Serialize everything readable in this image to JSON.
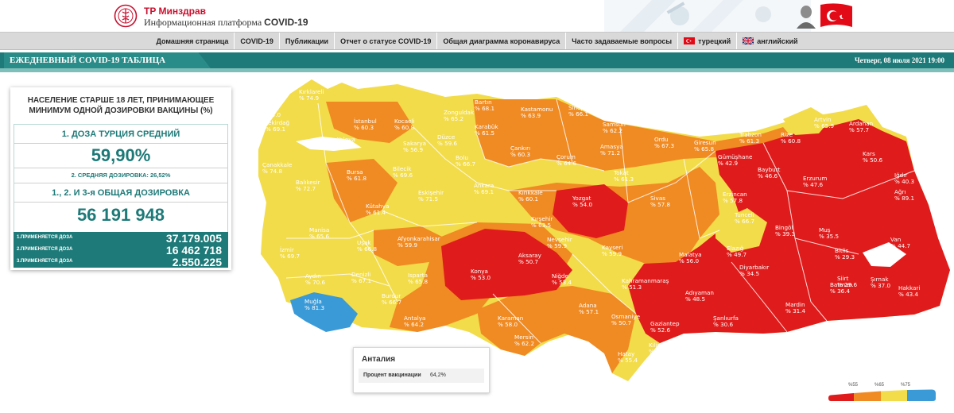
{
  "header": {
    "brand_line1": "TP Минздрав",
    "brand_line2_prefix": "Информационная платформа ",
    "brand_line2_bold": "COVID-19"
  },
  "nav": {
    "items": [
      {
        "label": "Домашняя страница"
      },
      {
        "label": "COVID-19"
      },
      {
        "label": "Публикации"
      },
      {
        "label": "Отчет о статусе COVID-19"
      },
      {
        "label": "Общая диаграмма коронавируса"
      },
      {
        "label": "Часто задаваемые вопросы"
      },
      {
        "label": "турецкий"
      },
      {
        "label": "английский"
      }
    ]
  },
  "titlebar": {
    "title": "ЕЖЕДНЕВНЫЙ COVID-19 ТАБЛИЦА",
    "date": "Четверг, 08 июля 2021 19:00"
  },
  "panel": {
    "heading": "НАСЕЛЕНИЕ СТАРШЕ 18 ЛЕТ, ПРИНИМАЮЩЕЕ МИНИМУМ ОДНОЙ ДОЗИРОВКИ ВАКЦИНЫ (%)",
    "dose1_label": "1. ДОЗА ТУРЦИЯ СРЕДНИЙ",
    "dose1_value": "59,90%",
    "dose2_line": "2. СРЕДНЯЯ ДОЗИРОВКА: 26,52%",
    "total_label": "1., 2. И 3-я ОБЩАЯ ДОЗИРОВКА",
    "total_value": "56 191 948",
    "rows": [
      {
        "label": "1.ПРИМЕНЯЕТСЯ ДОЗА",
        "value": "37.179.005"
      },
      {
        "label": "2.ПРИМЕНЯЕТСЯ ДОЗА",
        "value": "16 462 718"
      },
      {
        "label": "3.ПРИМЕНЯЕТСЯ ДОЗА",
        "value": "2.550.225"
      }
    ]
  },
  "tooltip": {
    "title": "Анталия",
    "key": "Процент вакцинации",
    "value": "64,2%"
  },
  "legend": {
    "labels": [
      "%55",
      "%65",
      "%75"
    ],
    "colors": [
      "#e01b1b",
      "#f08a22",
      "#f2dc4a",
      "#3a9ad8"
    ]
  },
  "colors": {
    "teal": "#1d7a78",
    "red": "#e01b1b",
    "orange": "#f08a22",
    "yellow": "#f2dc4a",
    "blue": "#3a9ad8"
  },
  "provinces": [
    {
      "name": "Kırklareli",
      "value": "% 74.9",
      "level": "yellow"
    },
    {
      "name": "Edirne",
      "value": "% 74.0",
      "level": "yellow"
    },
    {
      "name": "Tekirdağ",
      "value": "% 69.1",
      "level": "yellow"
    },
    {
      "name": "İstanbul",
      "value": "% 60.3",
      "level": "orange"
    },
    {
      "name": "Kocaeli",
      "value": "% 60.8",
      "level": "orange"
    },
    {
      "name": "Yalova",
      "value": "% 67.3",
      "level": "yellow"
    },
    {
      "name": "Sakarya",
      "value": "% 56.9",
      "level": "orange"
    },
    {
      "name": "Düzce",
      "value": "% 59.6",
      "level": "orange"
    },
    {
      "name": "Zonguldak",
      "value": "% 65.2",
      "level": "yellow"
    },
    {
      "name": "Bartın",
      "value": "% 68.1",
      "level": "yellow"
    },
    {
      "name": "Karabük",
      "value": "% 61.5",
      "level": "orange"
    },
    {
      "name": "Kastamonu",
      "value": "% 63.9",
      "level": "orange"
    },
    {
      "name": "Sinop",
      "value": "% 66.1",
      "level": "yellow"
    },
    {
      "name": "Samsun",
      "value": "% 62.2",
      "level": "orange"
    },
    {
      "name": "Çanakkale",
      "value": "% 74.8",
      "level": "yellow"
    },
    {
      "name": "Bursa",
      "value": "% 61.8",
      "level": "orange"
    },
    {
      "name": "Bilecik",
      "value": "% 69.6",
      "level": "yellow"
    },
    {
      "name": "Bolu",
      "value": "% 66.7",
      "level": "yellow"
    },
    {
      "name": "Çankırı",
      "value": "% 60.3",
      "level": "orange"
    },
    {
      "name": "Çorum",
      "value": "% 64.6",
      "level": "orange"
    },
    {
      "name": "Amasya",
      "value": "% 71.2",
      "level": "yellow"
    },
    {
      "name": "Tokat",
      "value": "% 61.3",
      "level": "orange"
    },
    {
      "name": "Ordu",
      "value": "% 67.3",
      "level": "yellow"
    },
    {
      "name": "Giresun",
      "value": "% 65.8",
      "level": "yellow"
    },
    {
      "name": "Trabzon",
      "value": "% 61.3",
      "level": "orange"
    },
    {
      "name": "Rize",
      "value": "% 60.8",
      "level": "orange"
    },
    {
      "name": "Artvin",
      "value": "% 65.9",
      "level": "yellow"
    },
    {
      "name": "Ardahan",
      "value": "% 57.7",
      "level": "orange"
    },
    {
      "name": "Gümüşhane",
      "value": "% 42.9",
      "level": "red"
    },
    {
      "name": "Bayburt",
      "value": "% 46.6",
      "level": "red"
    },
    {
      "name": "Kars",
      "value": "% 50.6",
      "level": "red"
    },
    {
      "name": "Erzurum",
      "value": "% 47.6",
      "level": "red"
    },
    {
      "name": "Iğdır",
      "value": "% 40.3",
      "level": "red"
    },
    {
      "name": "Ağrı",
      "value": "% 89.1",
      "level": "red"
    },
    {
      "name": "Balıkesir",
      "value": "% 72.7",
      "level": "yellow"
    },
    {
      "name": "Eskişehir",
      "value": "% 71.5",
      "level": "yellow"
    },
    {
      "name": "Ankara",
      "value": "% 69.1",
      "level": "yellow"
    },
    {
      "name": "Kırıkkale",
      "value": "% 60.1",
      "level": "orange"
    },
    {
      "name": "Yozgat",
      "value": "% 54.0",
      "level": "red"
    },
    {
      "name": "Sivas",
      "value": "% 57.8",
      "level": "orange"
    },
    {
      "name": "Erzincan",
      "value": "% 57.8",
      "level": "orange"
    },
    {
      "name": "Tunceli",
      "value": "% 66.7",
      "level": "yellow"
    },
    {
      "name": "Kütahya",
      "value": "% 61.4",
      "level": "orange"
    },
    {
      "name": "Kırşehir",
      "value": "% 63.5",
      "level": "orange"
    },
    {
      "name": "Manisa",
      "value": "% 65.6",
      "level": "yellow"
    },
    {
      "name": "Uşak",
      "value": "% 66.8",
      "level": "yellow"
    },
    {
      "name": "Afyonkarahisar",
      "value": "% 59.9",
      "level": "orange"
    },
    {
      "name": "Nevşehir",
      "value": "% 59.9",
      "level": "orange"
    },
    {
      "name": "Kayseri",
      "value": "% 59.9",
      "level": "orange"
    },
    {
      "name": "Malatya",
      "value": "% 56.0",
      "level": "orange"
    },
    {
      "name": "Elazığ",
      "value": "% 49.7",
      "level": "red"
    },
    {
      "name": "Bingöl",
      "value": "% 39.3",
      "level": "red"
    },
    {
      "name": "Muş",
      "value": "% 35.5",
      "level": "red"
    },
    {
      "name": "Van",
      "value": "% 44.7",
      "level": "red"
    },
    {
      "name": "Bitlis",
      "value": "% 29.3",
      "level": "red"
    },
    {
      "name": "İzmir",
      "value": "% 69.7",
      "level": "yellow"
    },
    {
      "name": "Aksaray",
      "value": "% 50.7",
      "level": "red"
    },
    {
      "name": "Konya",
      "value": "% 53.0",
      "level": "red"
    },
    {
      "name": "Niğde",
      "value": "% 53.4",
      "level": "red"
    },
    {
      "name": "Aydın",
      "value": "% 70.6",
      "level": "yellow"
    },
    {
      "name": "Denizli",
      "value": "% 67.1",
      "level": "yellow"
    },
    {
      "name": "Isparta",
      "value": "% 65.8",
      "level": "yellow"
    },
    {
      "name": "Burdur",
      "value": "% 66.7",
      "level": "yellow"
    },
    {
      "name": "Muğla",
      "value": "% 81.3",
      "level": "blue"
    },
    {
      "name": "Antalya",
      "value": "% 64.2",
      "level": "orange"
    },
    {
      "name": "Karaman",
      "value": "% 58.0",
      "level": "orange"
    },
    {
      "name": "Mersin",
      "value": "% 62.2",
      "level": "orange"
    },
    {
      "name": "Adana",
      "value": "% 57.1",
      "level": "orange"
    },
    {
      "name": "Osmaniye",
      "value": "% 50.7",
      "level": "red"
    },
    {
      "name": "Kahramanmaraş",
      "value": "% 51.3",
      "level": "red"
    },
    {
      "name": "Adıyaman",
      "value": "% 48.5",
      "level": "red"
    },
    {
      "name": "Diyarbakır",
      "value": "% 34.5",
      "level": "red"
    },
    {
      "name": "Batman",
      "value": "% 36.4",
      "level": "red"
    },
    {
      "name": "Siirt",
      "value": "% 29.6",
      "level": "red"
    },
    {
      "name": "Şırnak",
      "value": "% 37.0",
      "level": "red"
    },
    {
      "name": "Hakkari",
      "value": "% 43.4",
      "level": "red"
    },
    {
      "name": "Gaziantep",
      "value": "% 52.6",
      "level": "red"
    },
    {
      "name": "Şanlıurfa",
      "value": "% 30.6",
      "level": "red"
    },
    {
      "name": "Mardin",
      "value": "% 31.4",
      "level": "red"
    },
    {
      "name": "Kilis",
      "value": "% 56.5",
      "level": "orange"
    },
    {
      "name": "Hatay",
      "value": "% 55.4",
      "level": "orange"
    }
  ]
}
